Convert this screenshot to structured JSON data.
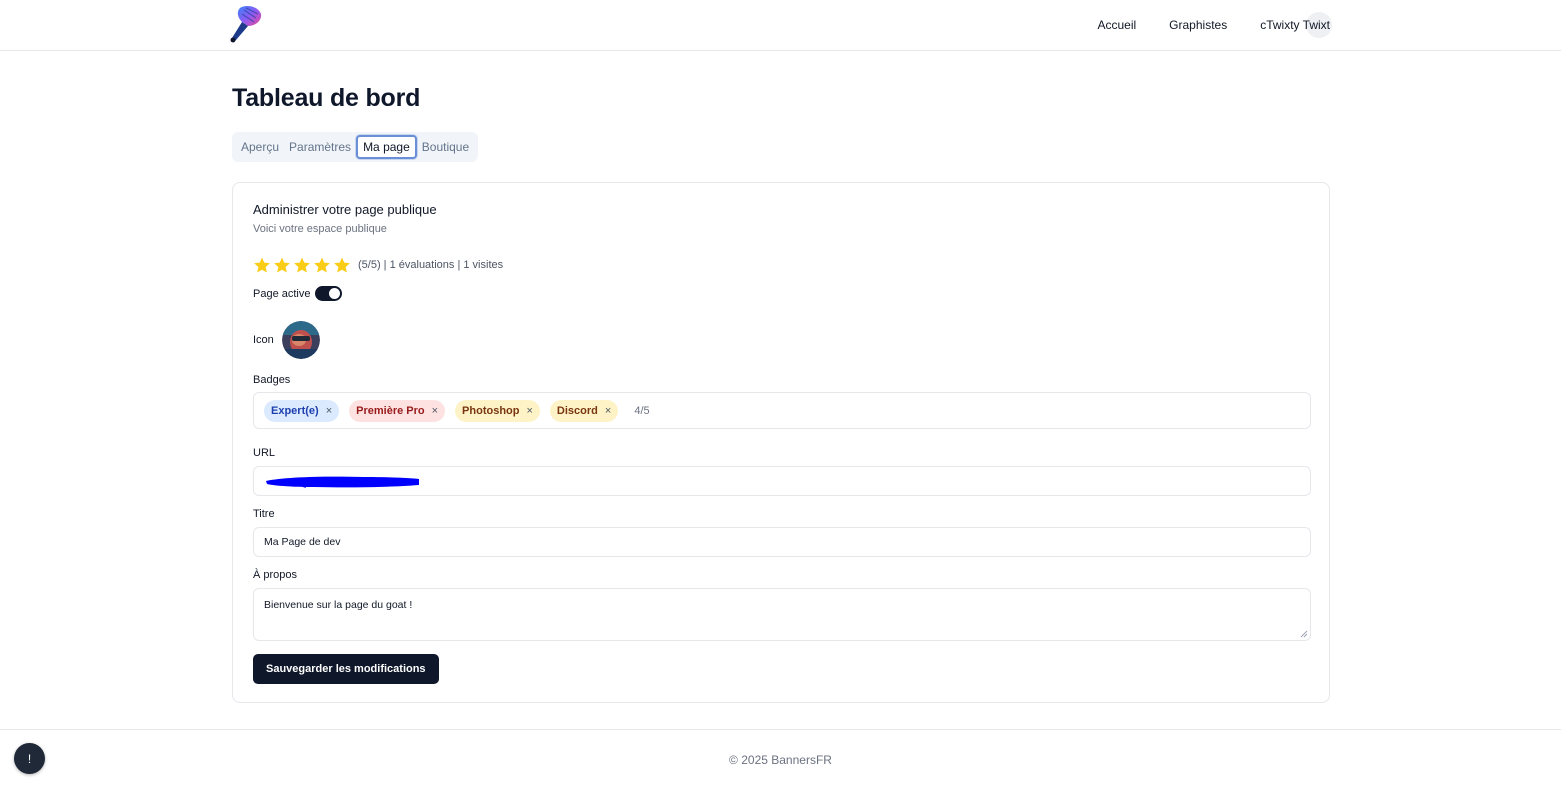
{
  "header": {
    "logo": "paintbrush-logo",
    "nav": [
      {
        "label": "Accueil"
      },
      {
        "label": "Graphistes"
      }
    ],
    "user_name": "cTwixty Twixt"
  },
  "page": {
    "title": "Tableau de bord",
    "tabs": [
      {
        "label": "Aperçu",
        "active": false
      },
      {
        "label": "Paramètres",
        "active": false
      },
      {
        "label": "Ma page",
        "active": true
      },
      {
        "label": "Boutique",
        "active": false
      }
    ]
  },
  "card": {
    "title": "Administrer votre page publique",
    "subtitle": "Voici votre espace publique",
    "rating": {
      "stars": 5,
      "max": 5,
      "text": "(5/5) | 1 évaluations | 1 visites"
    },
    "page_active": {
      "label": "Page active",
      "on": true
    },
    "icon_label": "Icon",
    "badges": {
      "label": "Badges",
      "items": [
        {
          "name": "Expert(e)",
          "bg": "#dbeafe",
          "color": "#1e40af"
        },
        {
          "name": "Première Pro",
          "bg": "#fee2e2",
          "color": "#991b1b"
        },
        {
          "name": "Photoshop",
          "bg": "#fef3c7",
          "color": "#78350f"
        },
        {
          "name": "Discord",
          "bg": "#fef3c7",
          "color": "#78350f"
        }
      ],
      "count": "4/5",
      "remove_glyph": "×"
    },
    "url": {
      "label": "URL",
      "value_redacted": true
    },
    "titre": {
      "label": "Titre",
      "value": "Ma Page de dev"
    },
    "apropos": {
      "label": "À propos",
      "value": "Bienvenue sur la page du goat !"
    },
    "save_label": "Sauvegarder les modifications"
  },
  "footer": {
    "text": "© 2025 BannersFR"
  },
  "fab": {
    "label": "!"
  },
  "colors": {
    "primary": "#0f172a",
    "star": "#facc15",
    "redaction": "#0000ff"
  }
}
